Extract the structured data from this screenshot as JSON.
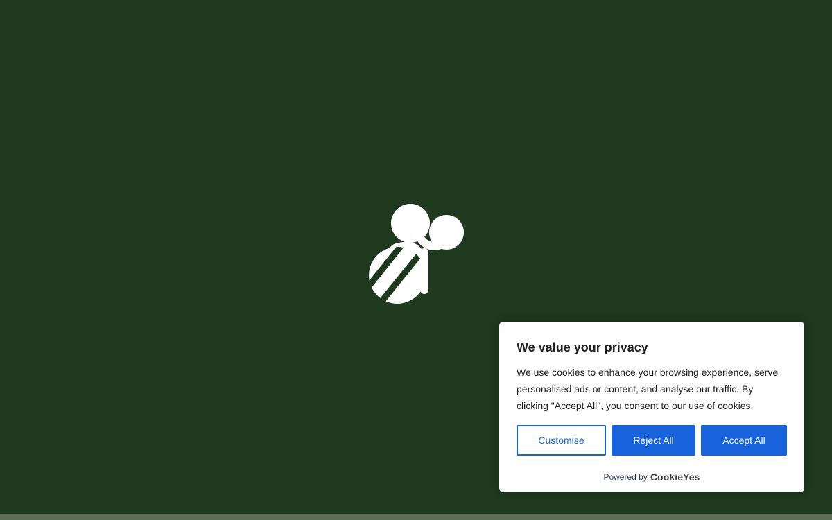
{
  "colors": {
    "background": "#1e391d",
    "accent": "#1863dc",
    "banner_bg": "#ffffff",
    "logo": "#ffffff"
  },
  "loader": {
    "icon": "bee-logo-icon"
  },
  "cookie_banner": {
    "title": "We value your privacy",
    "description": "We use cookies to enhance your browsing experience, serve personalised ads or content, and analyse our traffic. By clicking \"Accept All\", you consent to our use of cookies.",
    "buttons": {
      "customise": "Customise",
      "reject": "Reject All",
      "accept": "Accept All"
    },
    "powered_by": {
      "prefix": "Powered by",
      "brand": "CookieYes"
    }
  }
}
